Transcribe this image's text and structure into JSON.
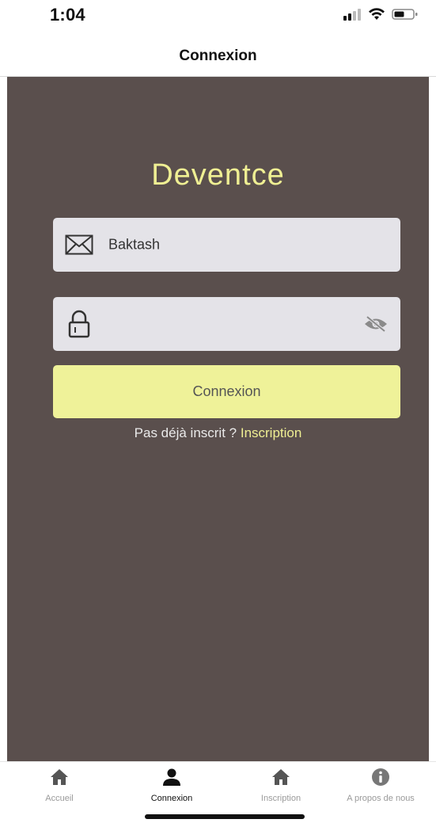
{
  "status_bar": {
    "time": "1:04"
  },
  "nav": {
    "title": "Connexion"
  },
  "login": {
    "brand": "Deventce",
    "username_value": "Baktash",
    "password_value": "",
    "button_label": "Connexion",
    "signup_prompt": "Pas déjà inscrit ?",
    "signup_link": "Inscription"
  },
  "tabs": [
    {
      "label": "Accueil",
      "icon": "home-icon",
      "active": false
    },
    {
      "label": "Connexion",
      "icon": "person-icon",
      "active": true
    },
    {
      "label": "Inscription",
      "icon": "home-icon",
      "active": false
    },
    {
      "label": "A propos de nous",
      "icon": "info-icon",
      "active": false
    }
  ],
  "colors": {
    "background": "#5a4f4d",
    "accent_yellow": "#eff299",
    "field_background": "#e4e3e8",
    "brand_text": "#efef93"
  }
}
